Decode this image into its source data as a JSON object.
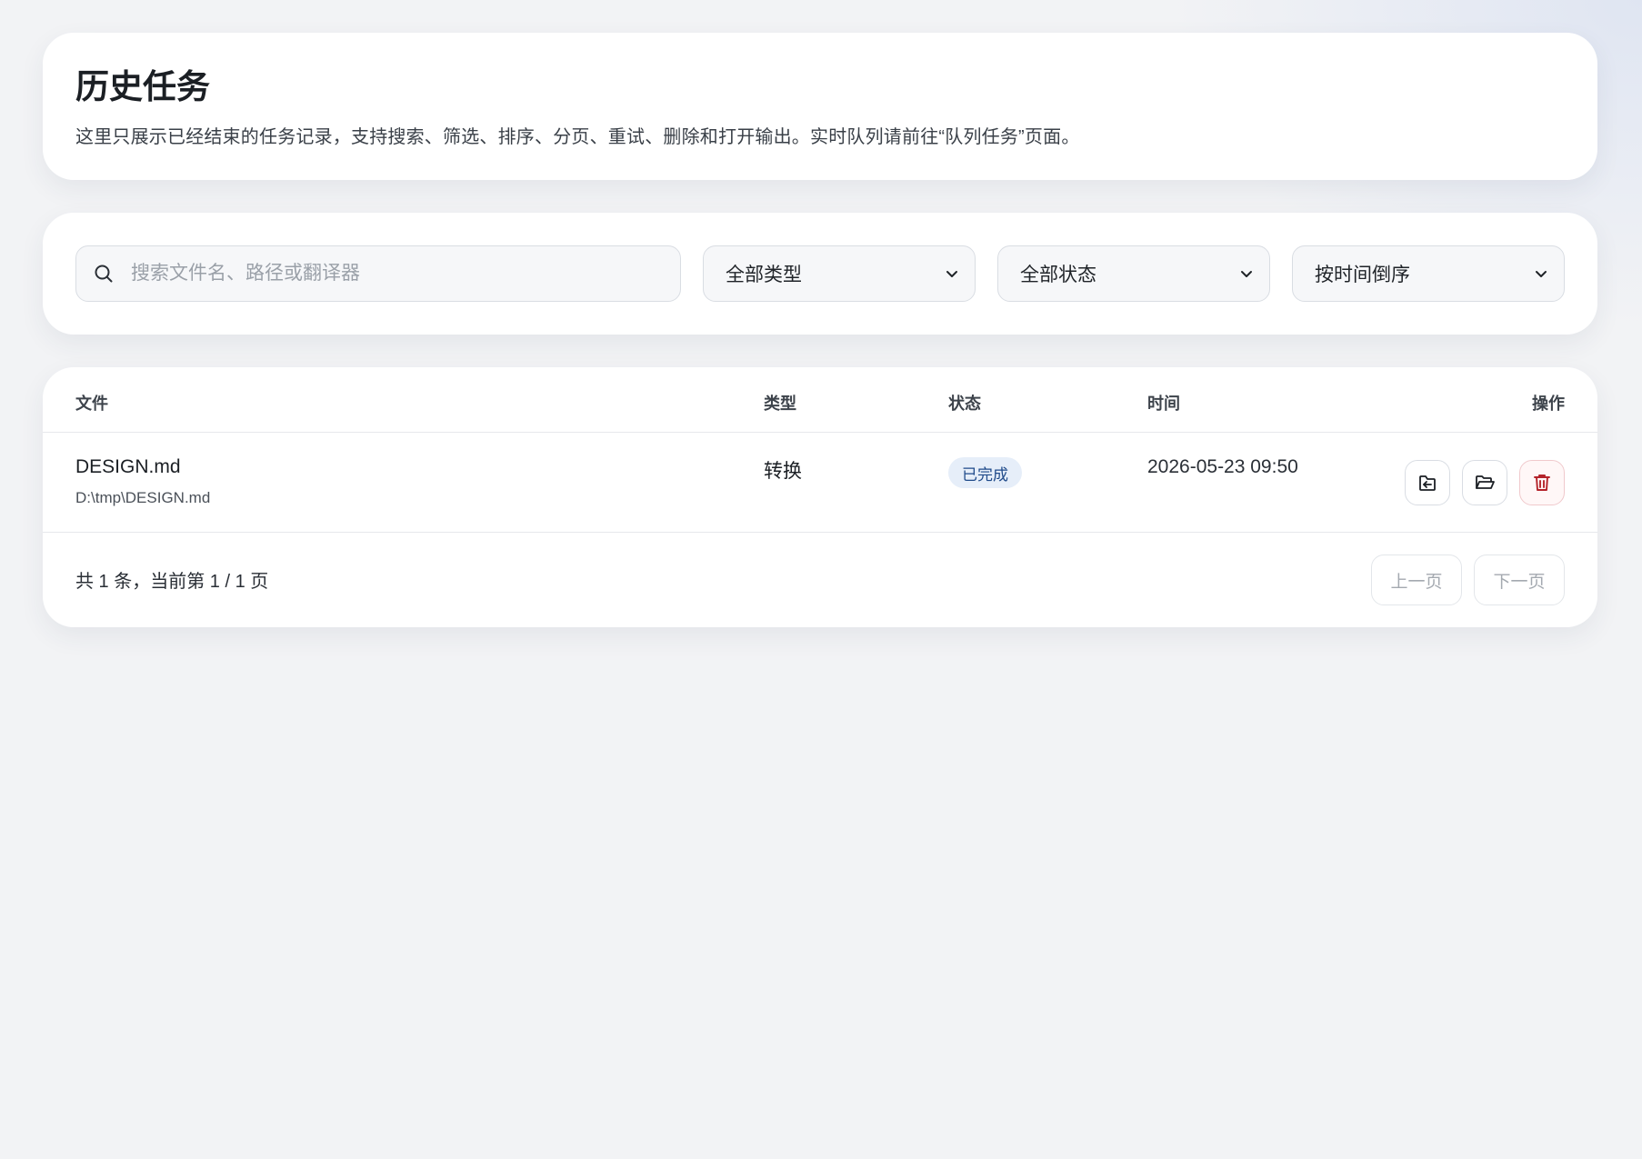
{
  "header": {
    "title": "历史任务",
    "description": "这里只展示已经结束的任务记录，支持搜索、筛选、排序、分页、重试、删除和打开输出。实时队列请前往“队列任务”页面。"
  },
  "filters": {
    "search_placeholder": "搜索文件名、路径或翻译器",
    "type_select": "全部类型",
    "status_select": "全部状态",
    "sort_select": "按时间倒序"
  },
  "table": {
    "columns": {
      "file": "文件",
      "type": "类型",
      "status": "状态",
      "time": "时间",
      "actions": "操作"
    },
    "rows": [
      {
        "name": "DESIGN.md",
        "path": "D:\\tmp\\DESIGN.md",
        "type": "转换",
        "status": "已完成",
        "time": "2026-05-23 09:50",
        "actions": [
          "open-output-icon",
          "open-folder-icon",
          "trash-icon"
        ]
      }
    ]
  },
  "pagination": {
    "summary": "共 1 条，当前第 1 / 1 页",
    "prev_label": "上一页",
    "next_label": "下一页"
  },
  "colors": {
    "status_badge_bg": "#e6eef9",
    "status_badge_text": "#1f4a8a",
    "danger": "#b4232a"
  }
}
